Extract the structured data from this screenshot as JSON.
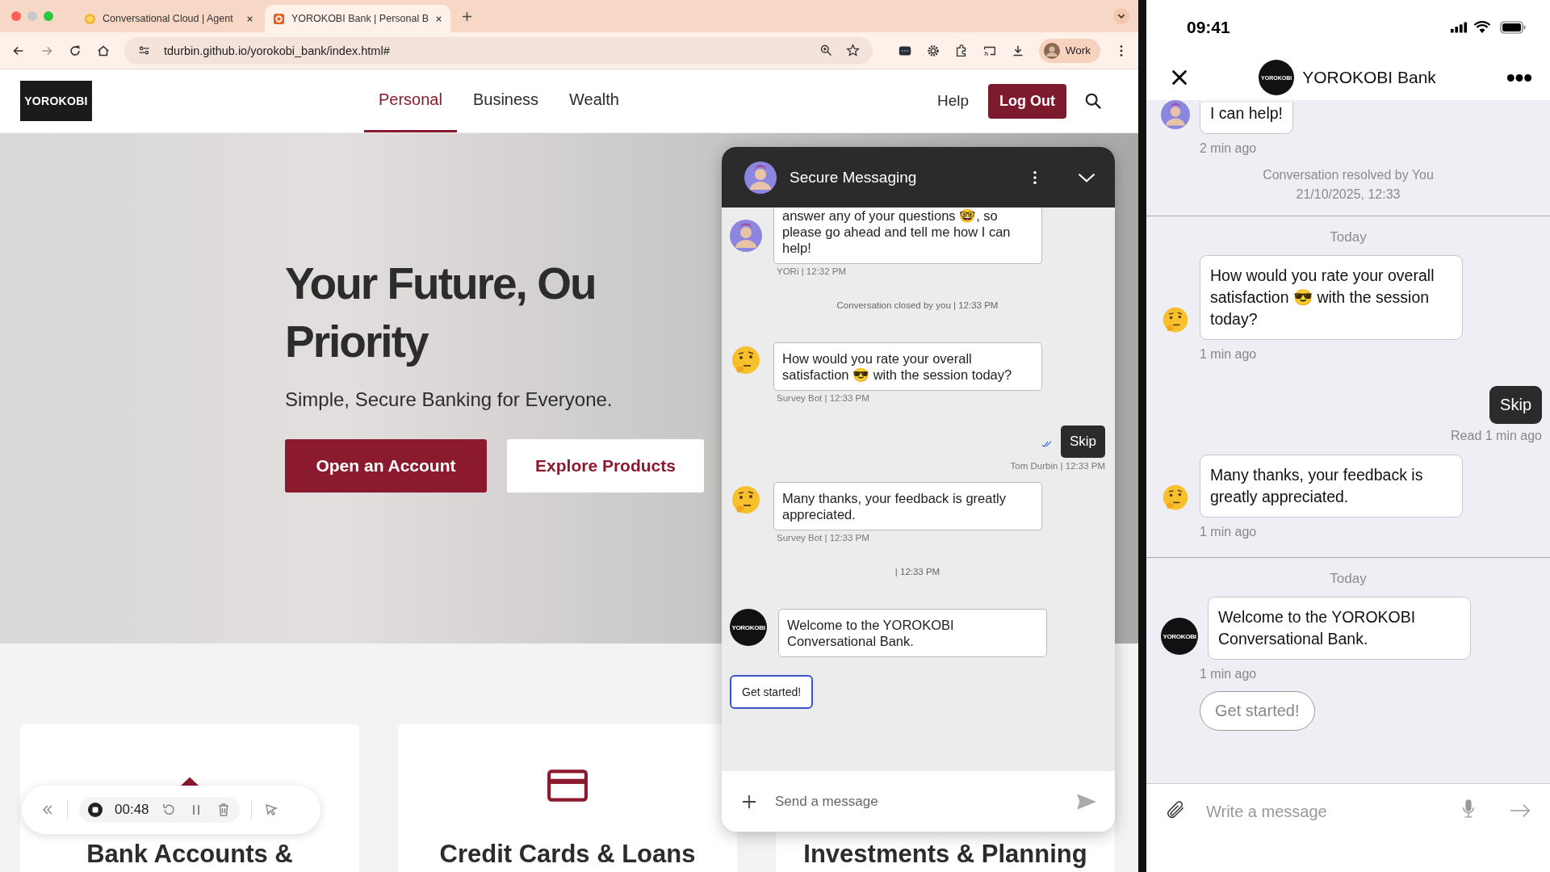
{
  "browser": {
    "tabs": [
      {
        "title": "Conversational Cloud | Agent",
        "selected": false
      },
      {
        "title": "YOROKOBI Bank | Personal B",
        "selected": true
      }
    ],
    "url": "tdurbin.github.io/yorokobi_bank/index.html#",
    "profile": "Work"
  },
  "site": {
    "logo": "YOROKOBI",
    "nav": [
      {
        "label": "Personal",
        "selected": true
      },
      {
        "label": "Business",
        "selected": false
      },
      {
        "label": "Wealth",
        "selected": false
      }
    ],
    "help": "Help",
    "logout": "Log Out",
    "hero": {
      "title_lines": [
        "Your Future, Ou",
        "Priority"
      ],
      "subtitle": "Simple, Secure Banking for Everyone.",
      "buttons": [
        {
          "label": "Open an Account",
          "kind": "primary"
        },
        {
          "label": "Explore Products",
          "kind": "secondary"
        }
      ]
    },
    "cards": [
      {
        "title": "Bank Accounts &"
      },
      {
        "title": "Credit Cards & Loans"
      },
      {
        "title": "Investments & Planning"
      }
    ]
  },
  "recorder": {
    "time": "00:48"
  },
  "chat_widget": {
    "title": "Secure Messaging",
    "messages": [
      {
        "kind": "agent",
        "text": "answer any of your questions 🤓, so please go ahead and tell me how I can help!",
        "meta": "YORi | 12:32 PM"
      },
      {
        "kind": "system",
        "text": "Conversation closed by you  | 12:33 PM"
      },
      {
        "kind": "bot",
        "text": "How would you rate your overall satisfaction 😎 with the session today?",
        "meta": "Survey Bot | 12:33 PM"
      },
      {
        "kind": "outgoing",
        "text": "Skip",
        "meta": "Tom Durbin | 12:33 PM",
        "read": true
      },
      {
        "kind": "bot",
        "text": "Many thanks, your feedback is greatly appreciated.",
        "meta": "Survey Bot | 12:33 PM"
      },
      {
        "kind": "system",
        "text": "| 12:33 PM"
      },
      {
        "kind": "brand",
        "avatar_text": "YOROKOBI",
        "text": "Welcome to the YOROKOBI Conversational Bank."
      },
      {
        "kind": "quick_reply",
        "text": "Get started!",
        "focused": true
      }
    ],
    "placeholder": "Send a message"
  },
  "phone": {
    "time": "09:41",
    "logo_text": "YOROKOBI",
    "title": "YOROKOBI Bank",
    "messages": [
      {
        "kind": "agent",
        "text": "I can help!",
        "meta": "2 min ago"
      },
      {
        "kind": "system",
        "text": "Conversation resolved by You",
        "date": "21/10/2025, 12:33"
      },
      {
        "kind": "day",
        "text": "Today"
      },
      {
        "kind": "bot",
        "text": "How would you rate your overall satisfaction 😎 with the session today?",
        "meta": "1 min ago"
      },
      {
        "kind": "outgoing",
        "text": "Skip",
        "meta": "Read 1 min ago"
      },
      {
        "kind": "bot",
        "text": "Many thanks, your feedback is greatly appreciated.",
        "meta": "1 min ago"
      },
      {
        "kind": "day",
        "text": "Today"
      },
      {
        "kind": "brand",
        "avatar_text": "YOROKOBI",
        "text": "Welcome to the YOROKOBI Conversational Bank.",
        "meta": "1 min ago"
      },
      {
        "kind": "quick_reply",
        "text": "Get started!",
        "focused": false
      }
    ],
    "placeholder": "Write a message"
  }
}
